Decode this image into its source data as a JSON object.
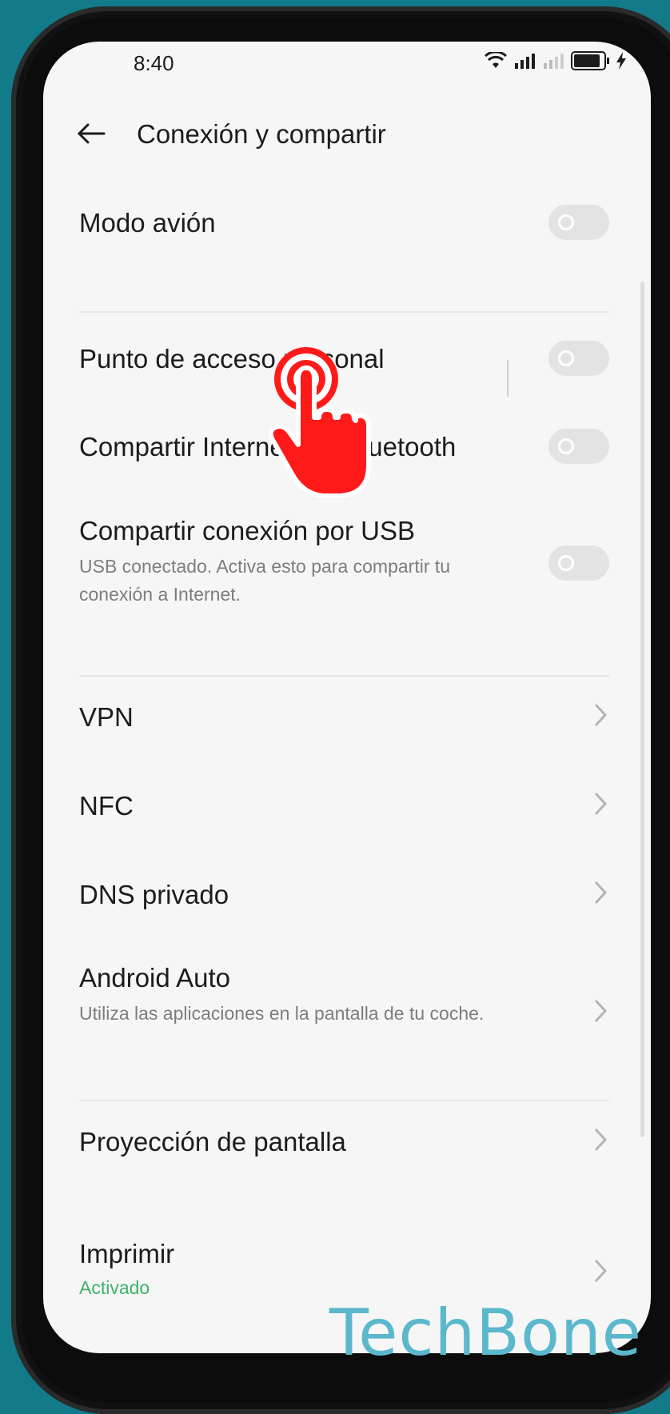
{
  "status_bar": {
    "time": "8:40"
  },
  "header": {
    "title": "Conexión y compartir"
  },
  "settings": {
    "airplane": {
      "label": "Modo avión"
    },
    "hotspot": {
      "label": "Punto de acceso personal"
    },
    "bluetooth_tethering": {
      "label": "Compartir Internet por Bluetooth"
    },
    "usb_tethering": {
      "label": "Compartir conexión por USB",
      "subtitle": "USB conectado. Activa esto para compartir tu conexión a Internet."
    },
    "vpn": {
      "label": "VPN"
    },
    "nfc": {
      "label": "NFC"
    },
    "private_dns": {
      "label": "DNS privado"
    },
    "android_auto": {
      "label": "Android Auto",
      "subtitle": "Utiliza las aplicaciones en la pantalla de tu coche."
    },
    "screen_cast": {
      "label": "Proyección de pantalla"
    },
    "print": {
      "label": "Imprimir",
      "status": "Activado"
    }
  },
  "watermark": "TechBone",
  "colors": {
    "background": "#137a8a",
    "screen": "#f6f6f6",
    "accent_status": "#3db36a",
    "tap_hand": "#ff1a1a"
  },
  "icons": [
    "wifi-icon",
    "signal-icon",
    "battery-icon",
    "back-arrow-icon",
    "chevron-right-icon",
    "tap-hand-icon"
  ]
}
